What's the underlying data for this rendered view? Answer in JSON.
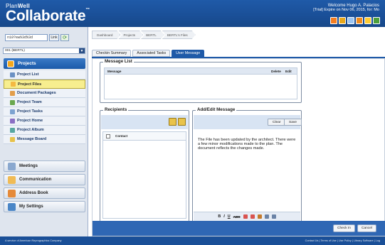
{
  "header": {
    "brand_small_a": "Plan",
    "brand_small_b": "Well",
    "brand_big": "Collaborate",
    "brand_tm": "™",
    "welcome_line1": "Welcome Hugo A. Palacios",
    "welcome_line2": "[Trial] Expire on Nov 06, 2015, for: Mo",
    "icon_colors": [
      "#f47d20",
      "#e8a81b",
      "#9bc5f2",
      "#f08c1d",
      "#ffcc33",
      "#4d9f3b"
    ]
  },
  "sidebar": {
    "id_value": "n10?ew%3d%3d",
    "link_label": "Link",
    "select_value": "001 (BERTL)",
    "projects_label": "Projects",
    "sub_items": [
      {
        "label": "Project List",
        "icon_color": "#6c91c3"
      },
      {
        "label": "Project Files",
        "icon_color": "#f4b942"
      },
      {
        "label": "Document Packages",
        "icon_color": "#e29e4b"
      },
      {
        "label": "Project Team",
        "icon_color": "#6aa84f"
      },
      {
        "label": "Project Tasks",
        "icon_color": "#7da3d1"
      },
      {
        "label": "Project Home",
        "icon_color": "#8a6fc4"
      },
      {
        "label": "Project Album",
        "icon_color": "#58a7a1"
      },
      {
        "label": "Message Board",
        "icon_color": "#e8c24a"
      }
    ],
    "groups": [
      {
        "label": "Meetings",
        "icon_color": "#8aa8cf"
      },
      {
        "label": "Communication",
        "icon_color": "#f0bb55"
      },
      {
        "label": "Address Book",
        "icon_color": "#e58a3a"
      },
      {
        "label": "My Settings",
        "icon_color": "#4a86c7"
      }
    ]
  },
  "breadcrumbs": [
    "Dashboard",
    "Projects",
    "BERTL",
    "BERTL's Files"
  ],
  "tabs": [
    "Checkin Summary",
    "Associated Tasks",
    "User Message"
  ],
  "message_list": {
    "title": "Message List",
    "col_message": "Message",
    "col_delete": "Delete",
    "col_edit": "Edit"
  },
  "recipients": {
    "title": "Recipients",
    "col_contact": "Contact"
  },
  "edit_message": {
    "title": "Add/Edit Message",
    "clear_label": "Clear",
    "save_label": "Save",
    "body": "The File has been updated by the architect. There were a few minor modifications made to the plan. The document reflects the changes made."
  },
  "editor_toolbar": [
    "B",
    "I",
    "U",
    "ABC"
  ],
  "actions": {
    "checkin_label": "Check In",
    "cancel_label": "Cancel"
  },
  "footer": {
    "left": "A service of American Reprographics Company",
    "right": "Contact Us | Terms of Use | Use Policy | Library Software | Log"
  }
}
